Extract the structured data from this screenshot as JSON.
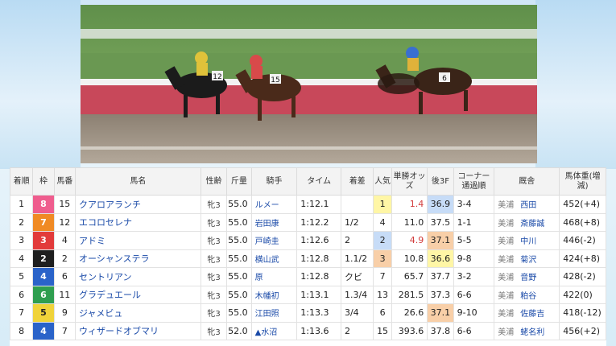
{
  "colors": {
    "frame1": "#ffffff",
    "frame2": "#1e1e1e",
    "frame3": "#e23b3b",
    "frame4": "#2a63c9",
    "frame5": "#f0d33a",
    "frame6": "#2e9e4f",
    "frame7": "#f08a24",
    "frame8": "#ef5d8e"
  },
  "headers": {
    "rank": "着順",
    "frame": "枠",
    "number": "馬番",
    "horse": "馬名",
    "sexage": "性齢",
    "weight": "斤量",
    "jockey": "騎手",
    "time": "タイム",
    "margin": "着差",
    "popularity": "人気",
    "odds": "単勝オッズ",
    "last3f": "後3F",
    "corner": "コーナー通過順",
    "stable": "厩舎",
    "bodyweight": "馬体重(増減)"
  },
  "rows": [
    {
      "rank": "1",
      "frame": "8",
      "frame_color": "#ef5d8e",
      "number": "15",
      "horse": "クアロアランチ",
      "sexage": "牝3",
      "weight": "55.0",
      "jockey": "ルメー",
      "time": "1:12.1",
      "margin": "",
      "popularity": "1",
      "pop_class": "pop1",
      "odds": "1.4",
      "odds_red": true,
      "last3f": "36.9",
      "l3_class": "l3-1",
      "corner": "3-4",
      "loc": "美浦",
      "trainer": "西田",
      "bodyweight": "452(+4)"
    },
    {
      "rank": "2",
      "frame": "7",
      "frame_color": "#f08a24",
      "number": "12",
      "horse": "エコロセレナ",
      "sexage": "牝3",
      "weight": "55.0",
      "jockey": "岩田康",
      "time": "1:12.2",
      "margin": "1/2",
      "popularity": "4",
      "pop_class": "",
      "odds": "11.0",
      "odds_red": false,
      "last3f": "37.5",
      "l3_class": "",
      "corner": "1-1",
      "loc": "美浦",
      "trainer": "斎藤誠",
      "bodyweight": "468(+8)"
    },
    {
      "rank": "3",
      "frame": "3",
      "frame_color": "#e23b3b",
      "number": "4",
      "horse": "アドミ",
      "sexage": "牝3",
      "weight": "55.0",
      "jockey": "戸崎圭",
      "time": "1:12.6",
      "margin": "2",
      "popularity": "2",
      "pop_class": "pop2",
      "odds": "4.9",
      "odds_red": true,
      "last3f": "37.1",
      "l3_class": "l3-2",
      "corner": "5-5",
      "loc": "美浦",
      "trainer": "中川",
      "bodyweight": "446(-2)"
    },
    {
      "rank": "4",
      "frame": "2",
      "frame_color": "#1e1e1e",
      "number": "2",
      "horse": "オーシャンステラ",
      "sexage": "牝3",
      "weight": "55.0",
      "jockey": "横山武",
      "time": "1:12.8",
      "margin": "1.1/2",
      "popularity": "3",
      "pop_class": "pop3",
      "odds": "10.8",
      "odds_red": false,
      "last3f": "36.6",
      "l3_class": "l3-3",
      "corner": "9-8",
      "loc": "美浦",
      "trainer": "菊沢",
      "bodyweight": "424(+8)"
    },
    {
      "rank": "5",
      "frame": "4",
      "frame_color": "#2a63c9",
      "number": "6",
      "horse": "セントリアン",
      "sexage": "牝3",
      "weight": "55.0",
      "jockey": "原",
      "time": "1:12.8",
      "margin": "クビ",
      "popularity": "7",
      "pop_class": "",
      "odds": "65.7",
      "odds_red": false,
      "last3f": "37.7",
      "l3_class": "",
      "corner": "3-2",
      "loc": "美浦",
      "trainer": "音野",
      "bodyweight": "428(-2)"
    },
    {
      "rank": "6",
      "frame": "6",
      "frame_color": "#2e9e4f",
      "number": "11",
      "horse": "グラデュエール",
      "sexage": "牝3",
      "weight": "55.0",
      "jockey": "木幡初",
      "time": "1:13.1",
      "margin": "1.3/4",
      "popularity": "13",
      "pop_class": "",
      "odds": "281.5",
      "odds_red": false,
      "last3f": "37.3",
      "l3_class": "",
      "corner": "6-6",
      "loc": "美浦",
      "trainer": "粕谷",
      "bodyweight": "422(0)"
    },
    {
      "rank": "7",
      "frame": "5",
      "frame_color": "#f0d33a",
      "number": "9",
      "horse": "ジャメビュ",
      "sexage": "牝3",
      "weight": "55.0",
      "jockey": "江田照",
      "time": "1:13.3",
      "margin": "3/4",
      "popularity": "6",
      "pop_class": "",
      "odds": "26.6",
      "odds_red": false,
      "last3f": "37.1",
      "l3_class": "l3-2",
      "corner": "9-10",
      "loc": "美浦",
      "trainer": "佐藤吉",
      "bodyweight": "418(-12)"
    },
    {
      "rank": "8",
      "frame": "4",
      "frame_color": "#2a63c9",
      "number": "7",
      "horse": "ウィザードオブマリ",
      "sexage": "牝3",
      "weight": "52.0",
      "jockey": "▲水沼",
      "time": "1:13.6",
      "margin": "2",
      "popularity": "15",
      "pop_class": "",
      "odds": "393.6",
      "odds_red": false,
      "last3f": "37.8",
      "l3_class": "",
      "corner": "6-6",
      "loc": "美浦",
      "trainer": "蛯名利",
      "bodyweight": "456(+2)"
    }
  ],
  "video": {
    "saddle_numbers": [
      "12",
      "15",
      "6"
    ]
  }
}
